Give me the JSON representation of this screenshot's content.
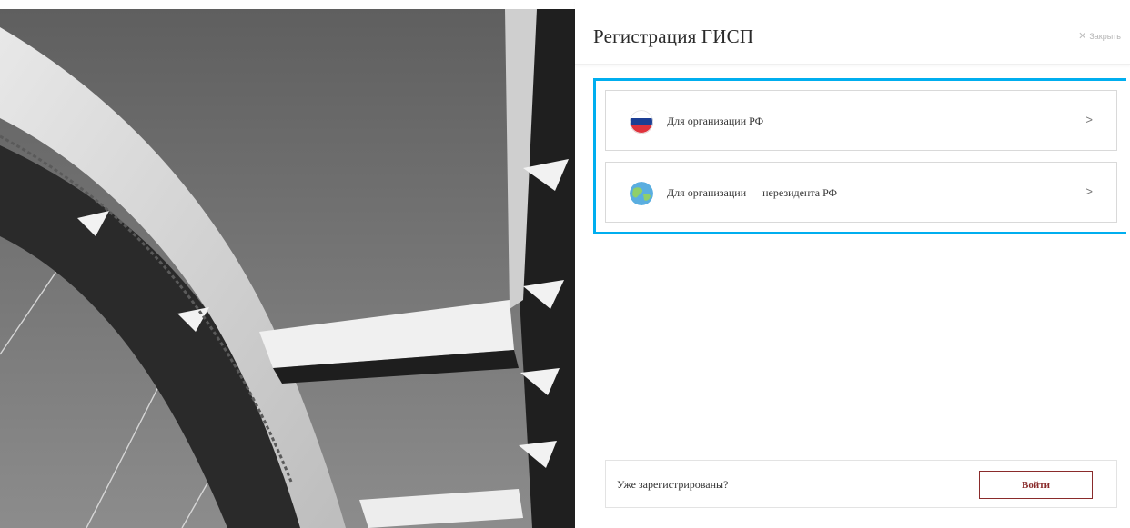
{
  "header": {
    "title": "Регистрация ГИСП",
    "close_label": "Закрыть",
    "close_icon": "close-icon"
  },
  "options": [
    {
      "label": "Для организации РФ",
      "icon": "russia-flag-icon",
      "chevron": ">"
    },
    {
      "label": "Для организации — нерезидента РФ",
      "icon": "globe-icon",
      "chevron": ">"
    }
  ],
  "footer": {
    "question": "Уже зарегистрированы?",
    "login_label": "Войти"
  },
  "colors": {
    "highlight": "#00aeef",
    "login_accent": "#8a2b2b",
    "flag_white": "#ffffff",
    "flag_blue": "#1c3f94",
    "flag_red": "#e0323c"
  }
}
